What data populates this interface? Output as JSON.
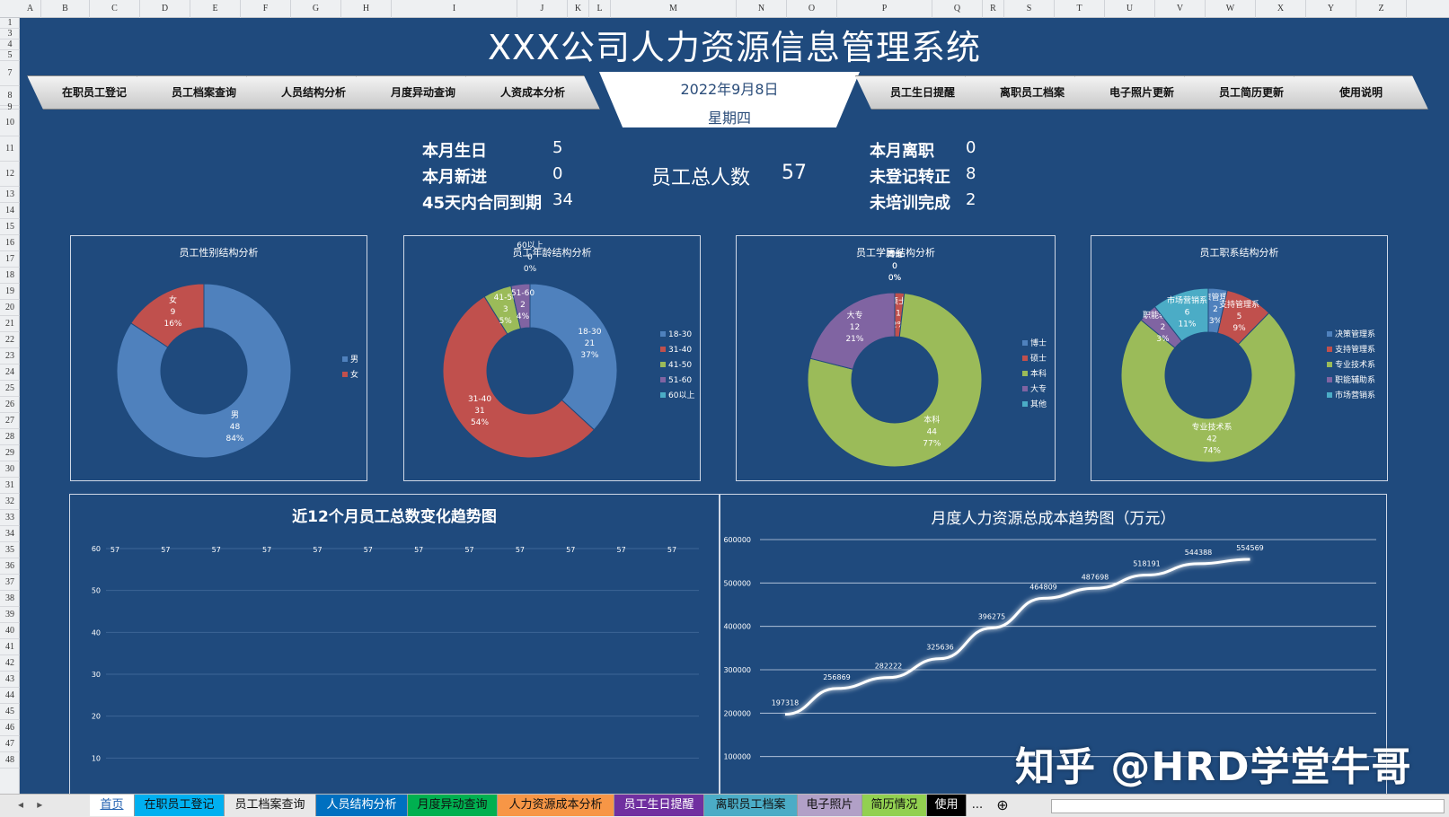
{
  "columns": [
    "A",
    "B",
    "C",
    "D",
    "E",
    "F",
    "G",
    "H",
    "I",
    "J",
    "K",
    "L",
    "M",
    "N",
    "O",
    "P",
    "Q",
    "R",
    "S",
    "T",
    "U",
    "V",
    "W",
    "X",
    "Y",
    "Z"
  ],
  "rows": [
    "1",
    "3",
    "4",
    "5",
    "7",
    "8",
    "9",
    "10",
    "11",
    "12",
    "13",
    "14",
    "15",
    "16",
    "17",
    "18",
    "19",
    "20",
    "21",
    "22",
    "23",
    "24",
    "25",
    "26",
    "27",
    "28",
    "29",
    "30",
    "31",
    "32",
    "33",
    "34",
    "35",
    "36",
    "37",
    "38",
    "39",
    "40",
    "41",
    "42",
    "43",
    "44",
    "45",
    "46",
    "47",
    "48"
  ],
  "title": "XXX公司人力资源信息管理系统",
  "nav_left": [
    "在职员工登记",
    "员工档案查询",
    "人员结构分析",
    "月度异动查询",
    "人资成本分析"
  ],
  "nav_right": [
    "员工生日提醒",
    "离职员工档案",
    "电子照片更新",
    "员工简历更新",
    "使用说明"
  ],
  "date": {
    "date_text": "2022年9月8日",
    "weekday": "星期四"
  },
  "stats": {
    "birthday_label": "本月生日",
    "birthday_value": "5",
    "new_label": "本月新进",
    "new_value": "0",
    "contract_label": "45天内合同到期",
    "contract_value": "34",
    "total_label": "员工总人数",
    "total_value": "57",
    "leave_label": "本月离职",
    "leave_value": "0",
    "unreg_label": "未登记转正",
    "unreg_value": "8",
    "untrained_label": "未培训完成",
    "untrained_value": "2"
  },
  "chart_data": [
    {
      "type": "pie",
      "title": "员工性别结构分析",
      "categories": [
        "男",
        "女"
      ],
      "values": [
        48,
        9
      ],
      "percent_labels": [
        "84%",
        "16%"
      ],
      "colors": [
        "#4f81bd",
        "#c0504d"
      ],
      "legend": [
        "男",
        "女"
      ],
      "legend_position": "right"
    },
    {
      "type": "pie",
      "title": "员工年龄结构分析",
      "categories": [
        "18-30",
        "31-40",
        "41-50",
        "51-60",
        "60以上"
      ],
      "values": [
        21,
        31,
        3,
        2,
        0
      ],
      "percent_labels": [
        "37%",
        "54%",
        "5%",
        "4%",
        "0%"
      ],
      "colors": [
        "#4f81bd",
        "#c0504d",
        "#9bbb59",
        "#8064a2",
        "#4bacc6"
      ],
      "legend": [
        "18-30",
        "31-40",
        "41-50",
        "51-60",
        "60以上"
      ],
      "legend_position": "right"
    },
    {
      "type": "pie",
      "title": "员工学历结构分析",
      "categories": [
        "博士",
        "硕士",
        "本科",
        "大专",
        "其他"
      ],
      "values": [
        0,
        1,
        44,
        12,
        0
      ],
      "percent_labels": [
        "0%",
        "2%",
        "77%",
        "21%",
        "0%"
      ],
      "colors": [
        "#4f81bd",
        "#c0504d",
        "#9bbb59",
        "#8064a2",
        "#4bacc6"
      ],
      "legend": [
        "博士",
        "硕士",
        "本科",
        "大专",
        "其他"
      ],
      "legend_position": "right"
    },
    {
      "type": "pie",
      "title": "员工职系结构分析",
      "categories": [
        "决策管理系",
        "支持管理系",
        "专业技术系",
        "职能辅助系",
        "市场营销系"
      ],
      "values": [
        2,
        5,
        42,
        2,
        6
      ],
      "percent_labels": [
        "3%",
        "9%",
        "74%",
        "3%",
        "11%"
      ],
      "colors": [
        "#4f81bd",
        "#c0504d",
        "#9bbb59",
        "#8064a2",
        "#4bacc6"
      ],
      "legend": [
        "决策管理系",
        "支持管理系",
        "专业技术系",
        "职能辅助系",
        "市场营销系"
      ],
      "legend_position": "right"
    },
    {
      "type": "line",
      "title": "近12个月员工总数变化趋势图",
      "values": [
        57,
        57,
        57,
        57,
        57,
        57,
        57,
        57,
        57,
        57,
        57,
        57
      ],
      "yticks": [
        "60",
        "50",
        "40",
        "30",
        "20",
        "10"
      ],
      "ylim": [
        0,
        60
      ]
    },
    {
      "type": "line",
      "title": "月度人力资源总成本趋势图（万元）",
      "values": [
        197318,
        256869,
        282222,
        325636,
        396275,
        464809,
        487698,
        518191,
        544388,
        554569
      ],
      "yticks": [
        "600000",
        "500000",
        "400000",
        "300000",
        "200000",
        "100000"
      ],
      "ylim": [
        0,
        600000
      ],
      "projection_points": 2
    }
  ],
  "sheet_tabs": [
    {
      "label": "首页",
      "bg": "#ffffff"
    },
    {
      "label": "在职员工登记",
      "bg": "#00b0f0"
    },
    {
      "label": "员工档案查询",
      "bg": "#e8e8e8"
    },
    {
      "label": "人员结构分析",
      "bg": "#0070c0"
    },
    {
      "label": "月度异动查询",
      "bg": "#00b050"
    },
    {
      "label": "人力资源成本分析",
      "bg": "#f79646"
    },
    {
      "label": "员工生日提醒",
      "bg": "#7030a0"
    },
    {
      "label": "离职员工档案",
      "bg": "#4bacc6"
    },
    {
      "label": "电子照片",
      "bg": "#b1a0c7"
    },
    {
      "label": "简历情况",
      "bg": "#92d050"
    },
    {
      "label": "使用",
      "bg": "#000000"
    }
  ],
  "sheet_more": "...",
  "watermark": "知乎 @HRD学堂牛哥"
}
